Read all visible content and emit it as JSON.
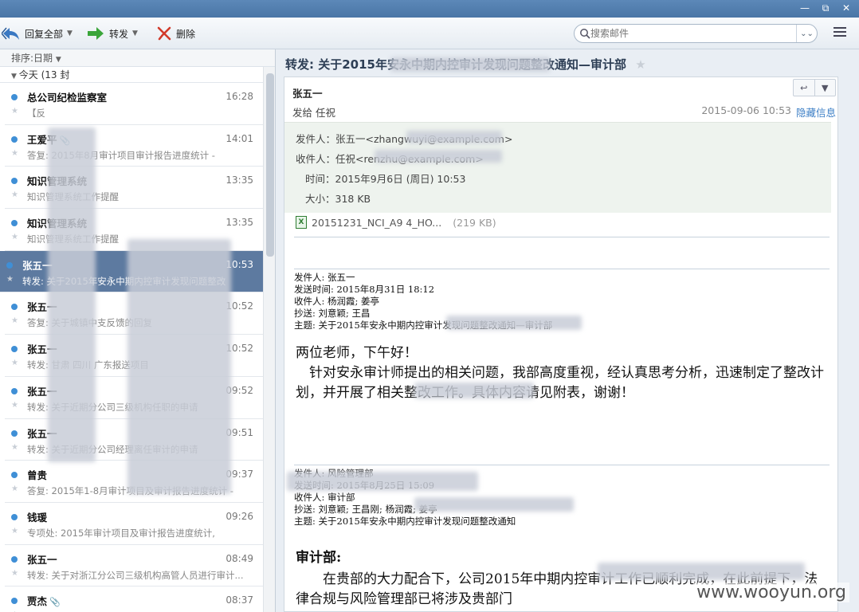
{
  "window": {
    "minimize": "—",
    "restore": "⧉",
    "close": "✕"
  },
  "toolbar": {
    "reply_all": "回复全部",
    "forward": "转发",
    "delete": "删除",
    "search_placeholder": "搜索邮件"
  },
  "list": {
    "sort_label": "排序:日期",
    "group_label": "今天 (13 封",
    "mails": [
      {
        "sender": "总公司纪检监察室",
        "time": "16:28",
        "preview": "【反",
        "attachment": false,
        "selected": false
      },
      {
        "sender": "王爱平",
        "time": "14:01",
        "preview": "答复: 2015年8月审计项目审计报告进度统计 -",
        "attachment": true,
        "selected": false
      },
      {
        "sender": "知识管理系统",
        "time": "13:35",
        "preview": "知识管理系统工作提醒",
        "attachment": false,
        "selected": false
      },
      {
        "sender": "知识管理系统",
        "time": "13:35",
        "preview": "知识管理系统工作提醒",
        "attachment": false,
        "selected": false
      },
      {
        "sender": "张五一",
        "time": "10:53",
        "preview": "转发: 关于2015年安永中期内控审计发现问题整改",
        "attachment": false,
        "selected": true
      },
      {
        "sender": "张五一",
        "time": "10:52",
        "preview": "答复: 关于城镇中支反馈的回复",
        "attachment": false,
        "selected": false
      },
      {
        "sender": "张五一",
        "time": "10:52",
        "preview": "转发: 甘肃 四川 广东报送项目",
        "attachment": false,
        "selected": false
      },
      {
        "sender": "张五一",
        "time": "09:52",
        "preview": "转发: 关于近期分公司三级机构任职的申请",
        "attachment": false,
        "selected": false
      },
      {
        "sender": "张五一",
        "time": "09:51",
        "preview": "转发: 关于近期分公司经理离任审计的申请",
        "attachment": false,
        "selected": false
      },
      {
        "sender": "曾贵",
        "time": "09:37",
        "preview": "答复: 2015年1-8月审计项目及审计报告进度统计 -",
        "attachment": false,
        "selected": false
      },
      {
        "sender": "钱瑗",
        "time": "09:26",
        "preview": "专项处: 2015年审计项目及审计报告进度统计,",
        "attachment": false,
        "selected": false
      },
      {
        "sender": "张五一",
        "time": "08:49",
        "preview": "转发: 关于对浙江分公司三级机构高管人员进行审计...",
        "attachment": false,
        "selected": false
      },
      {
        "sender": "贾杰",
        "time": "08:37",
        "preview": "",
        "attachment": true,
        "selected": false
      }
    ]
  },
  "reader": {
    "subject": "转发: 关于2015年安永中期内控审计发现问题整改通知—审计部",
    "from_name": "张五一",
    "to_line": "发给 任祝",
    "date": "2015-09-06 10:53",
    "hide_info": "隐藏信息",
    "meta": {
      "from": "发件人：张五一<zhangwuyi@example.com>",
      "to": "收件人：任祝<renzhu@example.com>",
      "time": "时间：2015年9月6日 (周日) 10:53",
      "size": "大小：318 KB"
    },
    "attachment": {
      "name": "20151231_NCI_A9 4_HO...",
      "size": "(219 KB)"
    },
    "fwd1": {
      "from": "发件人: 张五一",
      "sent": "发送时间: 2015年8月31日 18:12",
      "to": "收件人: 杨润霞; 姜亭",
      "cc": "抄送: 刘意颖; 王昌",
      "subject": "主题: 关于2015年安永中期内控审计发现问题整改通知—审计部"
    },
    "body1": [
      "两位老师，下午好！",
      "　针对安永审计师提出的相关问题，我部高度重视，经认真思考分析，迅速制定了整改计划，并开展了相关整改工作。具体内容请见附表，谢谢！"
    ],
    "fwd2": {
      "from": "发件人: 风险管理部",
      "sent": "发送时间: 2015年8月25日 15:09",
      "to": "收件人: 审计部",
      "cc": "抄送: 刘意颖; 王昌刚; 杨润霞; 姜亭",
      "subject": "主题: 关于2015年安永中期内控审计发现问题整改通知"
    },
    "heading2": "审计部:",
    "body2": "　　在贵部的大力配合下，公司2015年中期内控审计工作已顺利完成，在此前提下，法律合规与风险管理部已将涉及贵部门"
  },
  "watermark": "www.wooyun.org",
  "colors": {
    "accent": "#3d7fc6",
    "selected": "#5d7aa0",
    "unread_dot": "#3f8fd6"
  }
}
